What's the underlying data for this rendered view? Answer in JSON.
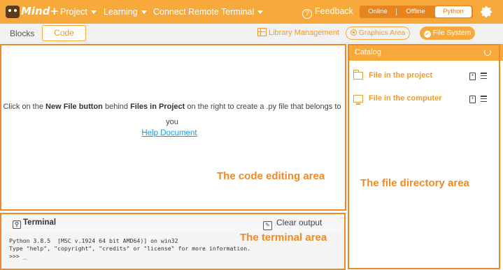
{
  "header": {
    "logo_text": "Mind+",
    "menus": [
      {
        "label": "Project"
      },
      {
        "label": "Learning"
      },
      {
        "label": "Connect Remote Terminal"
      }
    ],
    "feedback_label": "Feedback",
    "modes": [
      {
        "label": "Online",
        "active": false
      },
      {
        "label": "Offline",
        "active": false
      },
      {
        "label": "Python",
        "active": true
      }
    ]
  },
  "toolbar": {
    "tab_blocks": "Blocks",
    "tab_code": "Code",
    "library_management": "Library Management",
    "graphics_area": "Graphics Area",
    "file_system": "File System"
  },
  "editor": {
    "msg_pre": "Click on the ",
    "msg_bold1": "New File button",
    "msg_mid1": " behind ",
    "msg_bold2": "Files in Project",
    "msg_post": " on the right to create a .py file that belongs to you",
    "help_link": "Help Document"
  },
  "terminal": {
    "title": "Terminal",
    "clear_output": "Clear output",
    "lines": [
      "Python 3.8.5  [MSC v.1924 64 bit AMD64)] on win32",
      "Type \"help\", \"copyright\", \"credits\" or \"license\" for more information.",
      ">>> _"
    ]
  },
  "catalog": {
    "title": "Catalog",
    "items": [
      {
        "label": "File in the project",
        "icon": "folder-icon"
      },
      {
        "label": "File in the computer",
        "icon": "monitor-icon"
      }
    ]
  },
  "annotations": {
    "code_area": "The code editing area",
    "terminal_area": "The terminal area",
    "file_area": "The file directory area"
  },
  "colors": {
    "accent": "#f8a93b",
    "annotation": "#f08a24",
    "link": "#1a9ae8"
  }
}
